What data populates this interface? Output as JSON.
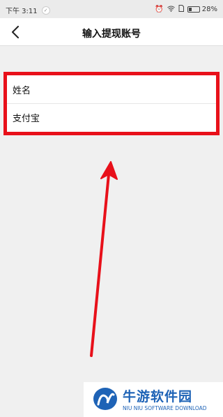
{
  "status_bar": {
    "time": "下午 3:11",
    "battery_percent": "28%",
    "battery_level": 0.28
  },
  "nav": {
    "title": "输入提现账号"
  },
  "form": {
    "rows": [
      {
        "label": "姓名"
      },
      {
        "label": "支付宝"
      }
    ]
  },
  "watermark": {
    "title": "牛游软件园",
    "subtitle": "NIU NIU SOFTWARE DOWNLOAD"
  },
  "colors": {
    "highlight": "#e8101a",
    "brand": "#1e63b6"
  }
}
